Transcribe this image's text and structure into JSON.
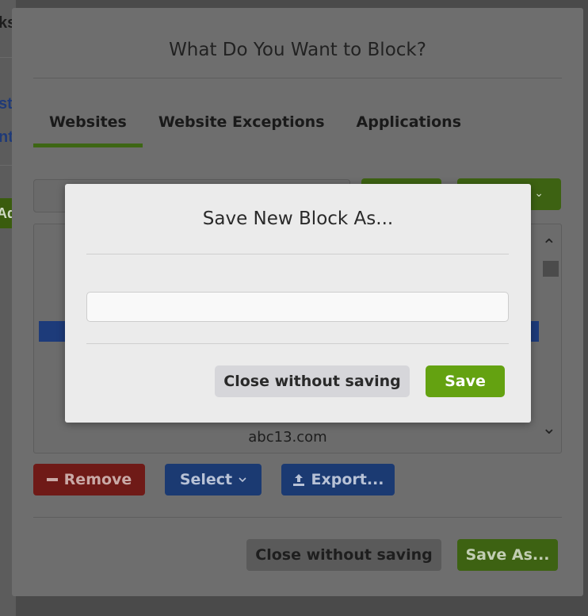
{
  "background": {
    "fragment_1": "ks",
    "fragment_2": "st",
    "fragment_3": "nt",
    "fragment_4": "Ad"
  },
  "outer_dialog": {
    "title": "What Do You Want to Block?",
    "tabs": [
      {
        "label": "Websites",
        "active": true
      },
      {
        "label": "Website Exceptions",
        "active": false
      },
      {
        "label": "Applications",
        "active": false
      }
    ],
    "list": {
      "visible_item": "abc13.com"
    },
    "buttons": {
      "remove": "Remove",
      "select": "Select",
      "export": "Export...",
      "close": "Close without saving",
      "save_as": "Save As..."
    }
  },
  "modal": {
    "title": "Save New Block As...",
    "name_input": {
      "value": "",
      "placeholder": ""
    },
    "buttons": {
      "close": "Close without saving",
      "save": "Save"
    }
  },
  "colors": {
    "accent_green": "#64a211",
    "primary_blue": "#2e62c9",
    "danger_red": "#d23a34",
    "overlay": "#4a4a4a"
  },
  "icons": {
    "remove": "minus-icon",
    "select": "chevron-down-icon",
    "export": "upload-icon",
    "scroll_up": "chevron-up-icon",
    "scroll_down": "chevron-down-icon"
  }
}
